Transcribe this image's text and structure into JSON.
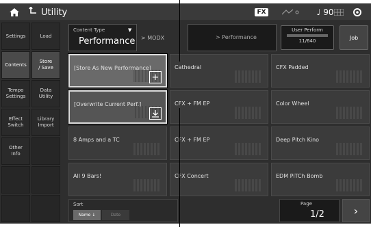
{
  "topbar": {
    "title": "Utility",
    "fx": "FX",
    "tempo": "90",
    "icons": [
      "home-icon",
      "utility-arrow-icon",
      "wave-icon",
      "note-icon",
      "grid-icon",
      "gear-icon"
    ]
  },
  "left_col1": [
    "Settings",
    "Contents",
    "Tempo\nSettings",
    "Effect\nSwitch",
    "Other\nInfo",
    "",
    ""
  ],
  "left_col2": [
    "Load",
    "Store\n/ Save",
    "Data\nUtility",
    "Library\nImport",
    "",
    "",
    ""
  ],
  "content_type": {
    "label": "Content Type",
    "value": "Performance",
    "source": "MODX",
    "dest": "Performance"
  },
  "user_perform": {
    "label": "User Perform",
    "count": "11/640"
  },
  "job_label": "Job",
  "cells": [
    "[Store As New Performance]",
    "Cathedral",
    "CFX Padded",
    "[Overwrite Current Perf.]",
    "CFX + FM EP",
    "Color Wheel",
    "8 Amps and a TC",
    "CFX + FM EP",
    "Deep Pitch Kino",
    "All 9 Bars!",
    "CFX Concert",
    "EDM PiTCh Bomb"
  ],
  "sort": {
    "label": "Sort",
    "name": "Name ↓",
    "date": "Date"
  },
  "page": {
    "label": "Page",
    "value": "1/2"
  },
  "colors": {
    "bg": "#2e2e2e",
    "cell": "#3b3b3b",
    "selected": "#555555"
  }
}
